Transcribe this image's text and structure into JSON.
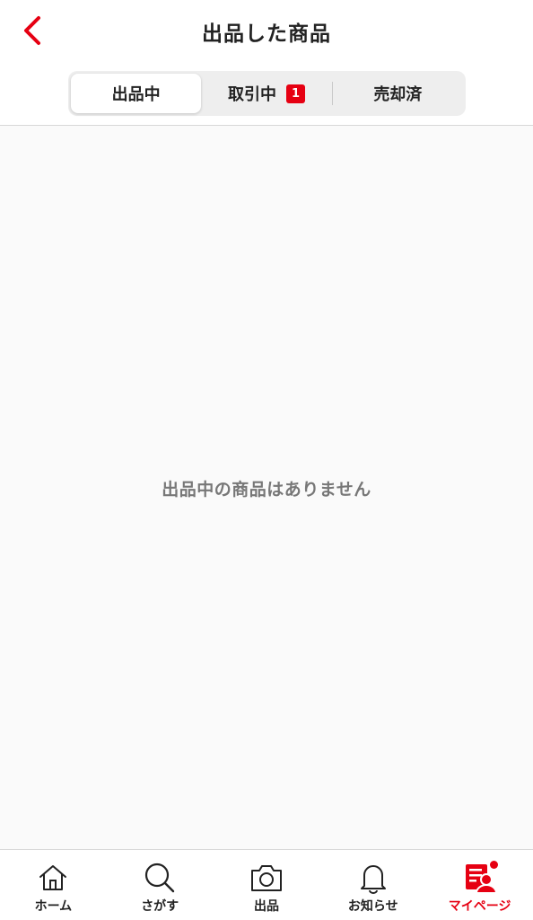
{
  "header": {
    "title": "出品した商品"
  },
  "tabs": [
    {
      "label": "出品中",
      "active": true
    },
    {
      "label": "取引中",
      "badge": "1"
    },
    {
      "label": "売却済"
    }
  ],
  "content": {
    "empty_message": "出品中の商品はありません"
  },
  "bottom_nav": {
    "items": [
      {
        "label": "ホーム",
        "icon": "home-icon"
      },
      {
        "label": "さがす",
        "icon": "search-icon"
      },
      {
        "label": "出品",
        "icon": "camera-icon"
      },
      {
        "label": "お知らせ",
        "icon": "bell-icon"
      },
      {
        "label": "マイページ",
        "icon": "mypage-icon",
        "active": true
      }
    ]
  },
  "colors": {
    "accent": "#e60012",
    "tab_bg": "#eeeeee",
    "muted_text": "#777777"
  }
}
